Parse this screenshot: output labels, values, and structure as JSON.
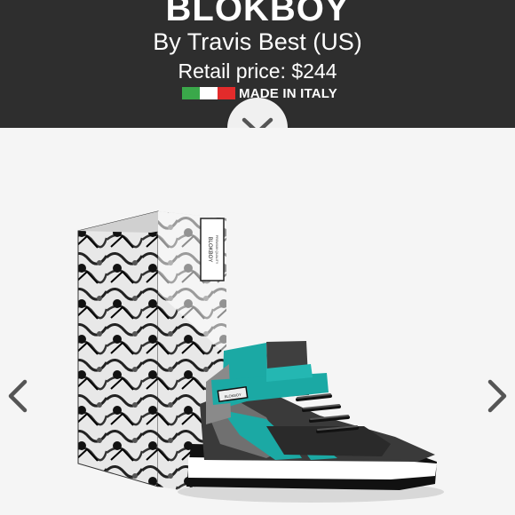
{
  "header": {
    "title": "BLOKBOY",
    "byline": "By Travis Best (US)",
    "price": "Retail price: $244",
    "made_in": "MADE IN ITALY",
    "background": "#2e2e2e",
    "flag_colors": [
      "#3aa84a",
      "#ffffff",
      "#e32b2b"
    ]
  },
  "controls": {
    "expand_icon": "chevron-down-icon",
    "prev_icon": "chevron-left-icon",
    "next_icon": "chevron-right-icon"
  },
  "product_image": {
    "box_label": "BLOKBOY",
    "box_sublabel": "PREMIUM QUALITY",
    "shoe_tag": "BLOKBOY",
    "accent_color": "#1ba9a4"
  }
}
